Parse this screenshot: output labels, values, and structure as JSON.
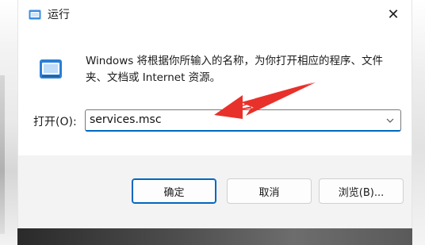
{
  "window": {
    "title": "运行",
    "close_glyph": "✕"
  },
  "description": "Windows 将根据你所输入的名称，为你打开相应的程序、文件夹、文档或 Internet 资源。",
  "open": {
    "label": "打开(O):",
    "value": "services.msc"
  },
  "buttons": {
    "ok": "确定",
    "cancel": "取消",
    "browse": "浏览(B)..."
  },
  "icons": {
    "title": "run-icon",
    "app": "run-app-icon",
    "dropdown": "chevron-down-icon",
    "close": "close-icon",
    "annotation": "red-arrow-icon"
  },
  "colors": {
    "accent": "#0067c0",
    "annotation": "#e8312a",
    "footer": "#f3f3f3"
  }
}
